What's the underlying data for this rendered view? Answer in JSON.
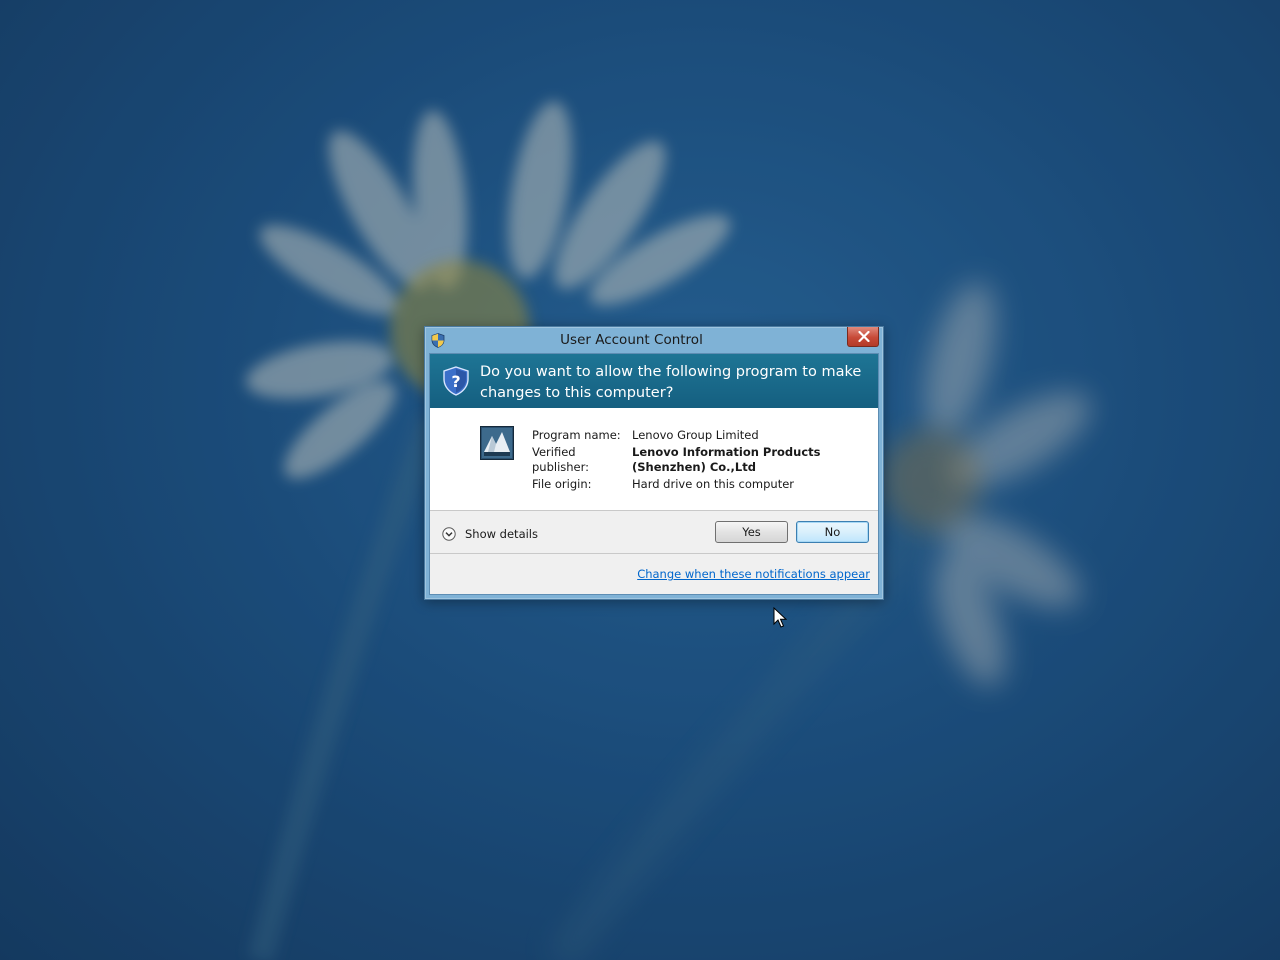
{
  "dialog": {
    "title": "User Account Control",
    "question": "Do you want to allow the following program to make changes to this computer?",
    "fields": [
      {
        "label": "Program name:",
        "value": "Lenovo Group Limited",
        "bold": false
      },
      {
        "label": "Verified publisher:",
        "value": "Lenovo Information Products (Shenzhen) Co.,Ltd",
        "bold": true
      },
      {
        "label": "File origin:",
        "value": "Hard drive on this computer",
        "bold": false
      }
    ],
    "show_details_label": "Show details",
    "yes_label": "Yes",
    "no_label": "No",
    "settings_link": "Change when these notifications appear"
  },
  "icons": {
    "title": "uac-shield-icon",
    "banner": "question-shield-icon",
    "program": "program-icon",
    "details": "chevron-down-circle-icon",
    "close": "close-icon",
    "cursor": "mouse-pointer-icon"
  },
  "colors": {
    "banner": "#1e7595",
    "link": "#0066cc",
    "close_button": "#c74a38",
    "desktop": "#1f5687"
  }
}
